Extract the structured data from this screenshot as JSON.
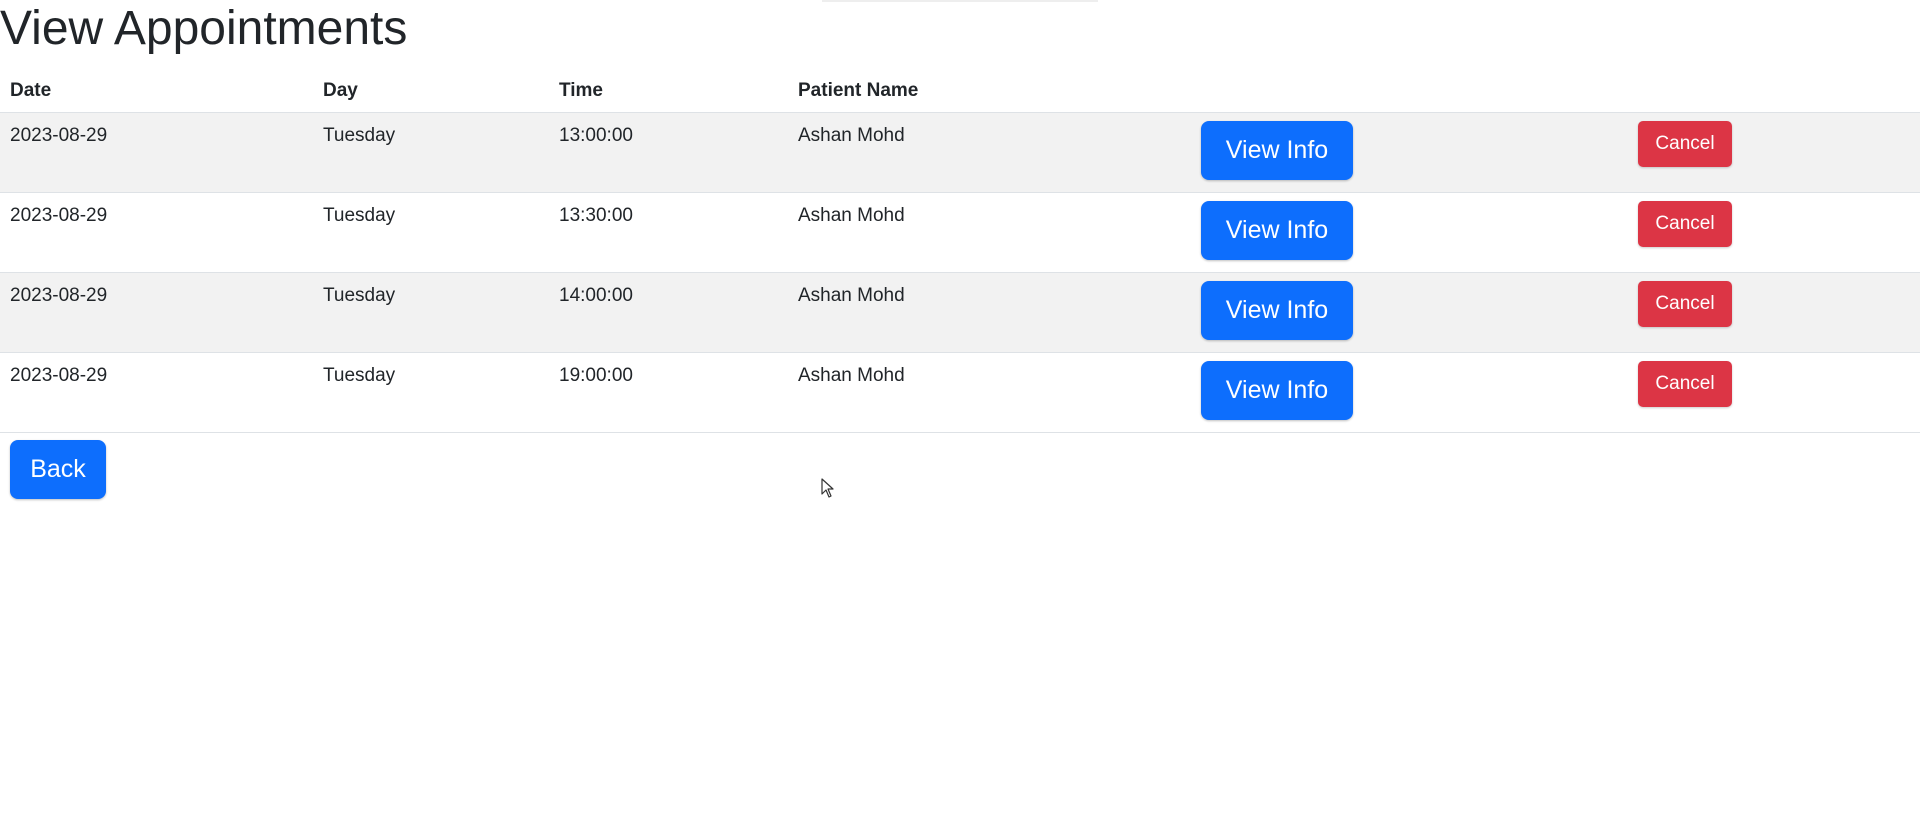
{
  "page": {
    "title": "View Appointments"
  },
  "table": {
    "headers": {
      "date": "Date",
      "day": "Day",
      "time": "Time",
      "patient_name": "Patient Name"
    },
    "rows": [
      {
        "date": "2023-08-29",
        "day": "Tuesday",
        "time": "13:00:00",
        "patient_name": "Ashan Mohd",
        "view_label": "View Info",
        "cancel_label": "Cancel"
      },
      {
        "date": "2023-08-29",
        "day": "Tuesday",
        "time": "13:30:00",
        "patient_name": "Ashan Mohd",
        "view_label": "View Info",
        "cancel_label": "Cancel"
      },
      {
        "date": "2023-08-29",
        "day": "Tuesday",
        "time": "14:00:00",
        "patient_name": "Ashan Mohd",
        "view_label": "View Info",
        "cancel_label": "Cancel"
      },
      {
        "date": "2023-08-29",
        "day": "Tuesday",
        "time": "19:00:00",
        "patient_name": "Ashan Mohd",
        "view_label": "View Info",
        "cancel_label": "Cancel"
      }
    ]
  },
  "actions": {
    "back_label": "Back"
  },
  "colors": {
    "primary": "#0d6efd",
    "danger": "#dc3545",
    "striped_row": "#f2f2f2",
    "text": "#212529"
  },
  "icons": {
    "cursor": "mouse-pointer-icon"
  }
}
